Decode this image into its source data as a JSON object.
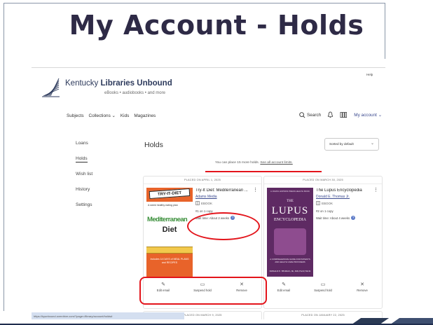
{
  "slide": {
    "title": "My Account - Holds"
  },
  "site": {
    "help": "Help",
    "brand_prefix": "Kentucky ",
    "brand_L": "Libraries",
    "brand_mid": " ",
    "brand_U": "Unbound",
    "tagline": "eBooks • audiobooks • and more"
  },
  "nav": {
    "items": [
      "Subjects",
      "Collections ⌄",
      "Kids",
      "Magazines"
    ],
    "search_label": "Search",
    "account_label": "My account ⌄"
  },
  "sidebar": {
    "items": [
      "Loans",
      "Holds",
      "Wish list",
      "History",
      "Settings"
    ]
  },
  "holds": {
    "title": "Holds",
    "sort_label": "Sorted by default",
    "info_text": "You can place 15 more holds. ",
    "info_link": "See all account limits."
  },
  "cards": [
    {
      "placed": "PLACED ON APRIL 1, 2025",
      "title": "Try-It Diet: Mediterranean ...",
      "author": "Adams Media",
      "format": "EBOOK",
      "copy": "#1 on 1 copy",
      "wait": "Wait time: About 2 weeks",
      "cover": {
        "top": "TRY-IT-DIET",
        "sub": "A week healthy eating plan",
        "main1": "Mediterranean",
        "main2": "Diet",
        "note": "Includes 14 DAYS of MEAL PLANS and RECIPES"
      },
      "actions": [
        "Edit email",
        "Suspend hold",
        "Remove"
      ]
    },
    {
      "placed": "PLACED ON MARCH 30, 2025",
      "title": "The Lupus Encyclopedia",
      "author": "Donald E. Thomas Jr.",
      "format": "EBOOK",
      "copy": "#2 on 1 copy",
      "wait": "Wait time: About 4 weeks",
      "cover": {
        "top": "A JOHNS HOPKINS PRESS HEALTH BOOK",
        "the": "THE",
        "main1": "LUPUS",
        "main2": "ENCYCLOPEDIA",
        "note": "A COMPREHENSIVE GUIDE FOR PATIENTS AND HEALTH CARE PROVIDERS",
        "author": "DONALD E. THOMAS, JR., MD, FACP, FACR"
      },
      "actions": [
        "Edit email",
        "Suspend hold",
        "Remove"
      ]
    }
  ],
  "next_cards": [
    "PLACED ON MARCH 9, 2025",
    "PLACED ON JANUARY 22, 2025"
  ],
  "statusbar": "https://kyunbound.overdrive.com/?page=/library/account/holds#",
  "colors": {
    "title": "#2e2a46",
    "annotation": "#e3141b",
    "link": "#3b4a8f",
    "diet_orange": "#e8632a",
    "lupus_purple": "#5e2a63"
  }
}
